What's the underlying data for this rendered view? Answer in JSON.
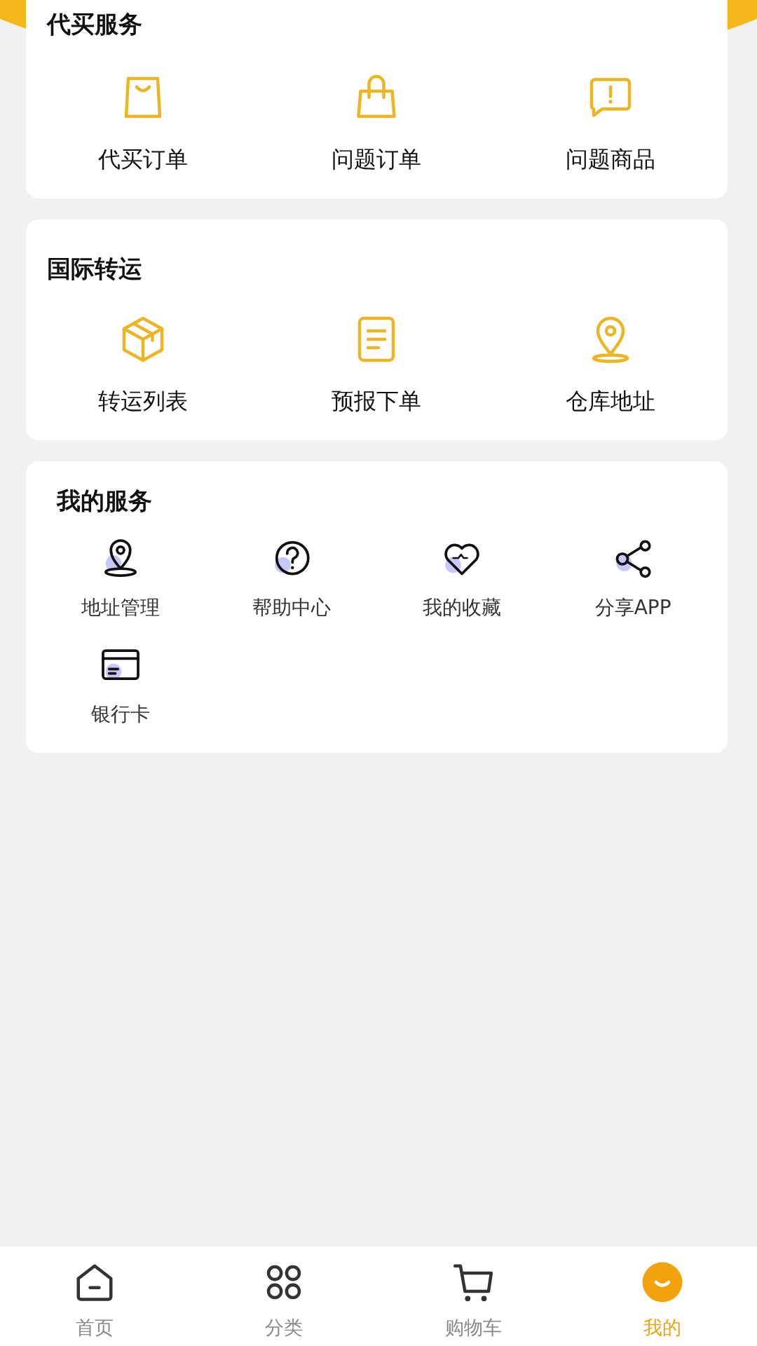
{
  "sections": [
    {
      "title": "代买服务",
      "kind": "large",
      "items": [
        {
          "label": "代买订单"
        },
        {
          "label": "问题订单"
        },
        {
          "label": "问题商品"
        }
      ]
    },
    {
      "title": "国际转运",
      "kind": "large",
      "items": [
        {
          "label": "转运列表"
        },
        {
          "label": "预报下单"
        },
        {
          "label": "仓库地址"
        }
      ]
    },
    {
      "title": "我的服务",
      "kind": "small",
      "items": [
        {
          "label": "地址管理"
        },
        {
          "label": "帮助中心"
        },
        {
          "label": "我的收藏"
        },
        {
          "label": "分享APP"
        },
        {
          "label": "银行卡"
        }
      ]
    }
  ],
  "tab_bar": [
    {
      "label": "首页",
      "selected": false
    },
    {
      "label": "分类",
      "selected": false
    },
    {
      "label": "购物车",
      "selected": false
    },
    {
      "label": "我的",
      "selected": true
    }
  ]
}
